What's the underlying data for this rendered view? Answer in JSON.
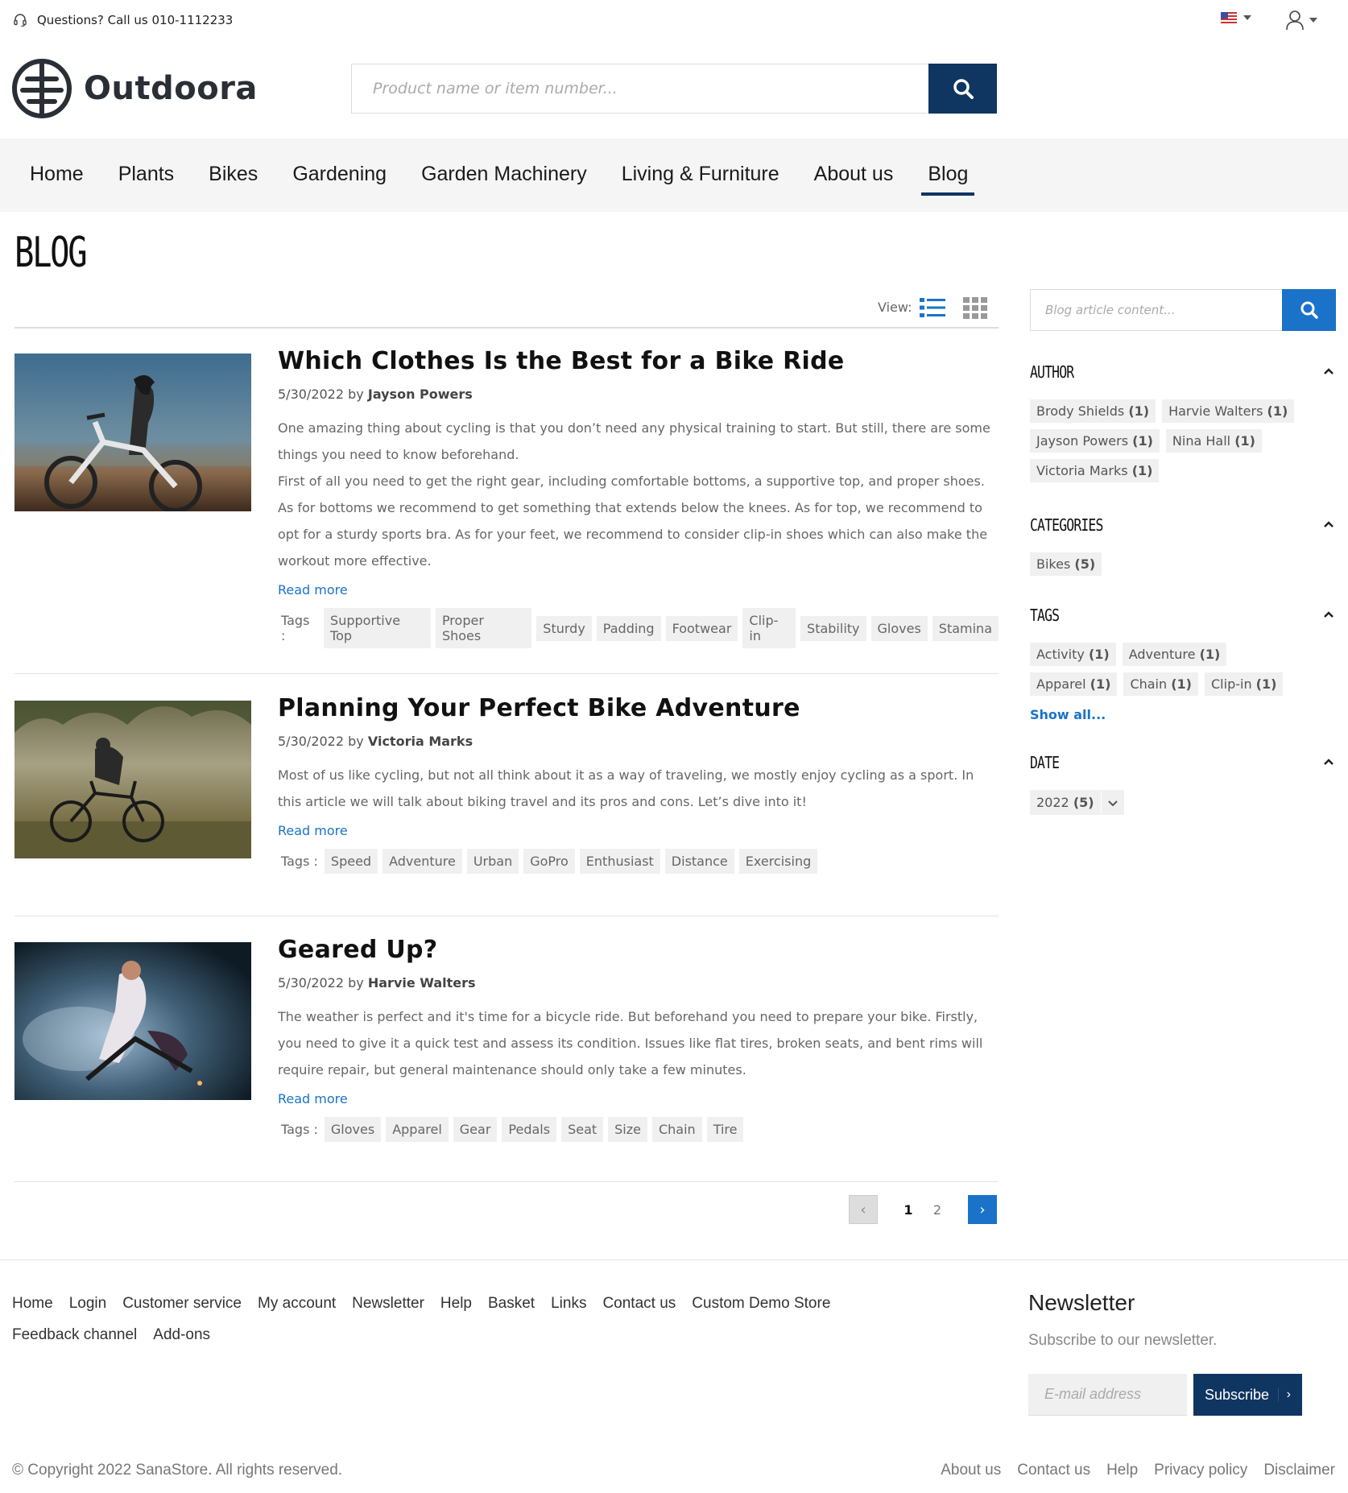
{
  "topbar": {
    "phone_text": "Questions? Call us 010-1112233",
    "language_icon": "us-flag-icon",
    "account_icon": "user-icon"
  },
  "header": {
    "logo_text": "Outdoora",
    "search_placeholder": "Product name or item number..."
  },
  "nav": {
    "items": [
      "Home",
      "Plants",
      "Bikes",
      "Gardening",
      "Garden Machinery",
      "Living & Furniture",
      "About us",
      "Blog"
    ],
    "active": "Blog"
  },
  "page": {
    "title": "BLOG",
    "view_label": "View:"
  },
  "articles": [
    {
      "title": "Which Clothes Is the Best for a Bike Ride",
      "date": "5/30/2022",
      "by": "by",
      "author": "Jayson Powers",
      "paragraphs": [
        "One amazing thing about cycling is that you don’t need any physical training to start. But still, there are some things you need to know beforehand.",
        "First of all you need to get the right gear, including comfortable bottoms, a supportive top, and proper shoes. As for bottoms we recommend to get something that extends below the knees. As for top, we recommend to opt for a sturdy sports bra. As for your feet, we recommend to consider clip-in shoes which can also make the workout more effective."
      ],
      "read_more": "Read more",
      "tags_label": "Tags :",
      "tags": [
        "Supportive Top",
        "Proper Shoes",
        "Sturdy",
        "Padding",
        "Footwear",
        "Clip-in",
        "Stability",
        "Gloves",
        "Stamina"
      ]
    },
    {
      "title": "Planning Your Perfect Bike Adventure",
      "date": "5/30/2022",
      "by": "by",
      "author": "Victoria Marks",
      "paragraphs": [
        "Most of us like cycling, but not all think about it as a way of traveling, we mostly enjoy cycling as a sport. In this article we will talk about  biking travel and  its pros and cons. Let’s dive into it!"
      ],
      "read_more": "Read more",
      "tags_label": "Tags :",
      "tags": [
        "Speed",
        "Adventure",
        "Urban",
        "GoPro",
        "Enthusiast",
        "Distance",
        "Exercising"
      ]
    },
    {
      "title": "Geared Up?",
      "date": "5/30/2022",
      "by": "by",
      "author": "Harvie Walters",
      "paragraphs": [
        "The weather is perfect and it's time for a bicycle ride. But beforehand you need to prepare your bike. Firstly, you need to give it a quick test and assess its condition. Issues like flat tires, broken seats, and bent rims will require repair, but general maintenance should only take a few minutes."
      ],
      "read_more": "Read more",
      "tags_label": "Tags :",
      "tags": [
        "Gloves",
        "Apparel",
        "Gear",
        "Pedals",
        "Seat",
        "Size",
        "Chain",
        "Tire"
      ]
    }
  ],
  "pagination": {
    "prev": "‹",
    "pages": [
      "1",
      "2"
    ],
    "current": "1",
    "next": "›"
  },
  "sidebar": {
    "search_placeholder": "Blog article content...",
    "facets": {
      "author": {
        "title": "AUTHOR",
        "items": [
          {
            "name": "Brody Shields",
            "count": "(1)"
          },
          {
            "name": "Harvie Walters",
            "count": "(1)"
          },
          {
            "name": "Jayson Powers",
            "count": "(1)"
          },
          {
            "name": "Nina Hall",
            "count": "(1)"
          },
          {
            "name": "Victoria Marks",
            "count": "(1)"
          }
        ]
      },
      "categories": {
        "title": "CATEGORIES",
        "items": [
          {
            "name": "Bikes",
            "count": "(5)"
          }
        ]
      },
      "tags": {
        "title": "TAGS",
        "items": [
          {
            "name": "Activity",
            "count": "(1)"
          },
          {
            "name": "Adventure",
            "count": "(1)"
          },
          {
            "name": "Apparel",
            "count": "(1)"
          },
          {
            "name": "Chain",
            "count": "(1)"
          },
          {
            "name": "Clip-in",
            "count": "(1)"
          }
        ],
        "show_all": "Show all..."
      },
      "date": {
        "title": "DATE",
        "year": "2022",
        "count": "(5)"
      }
    }
  },
  "footer": {
    "links": [
      "Home",
      "Login",
      "Customer service",
      "My account",
      "Newsletter",
      "Help",
      "Basket",
      "Links",
      "Contact us",
      "Custom Demo Store",
      "Feedback channel",
      "Add-ons"
    ],
    "newsletter_title": "Newsletter",
    "newsletter_sub": "Subscribe to our newsletter.",
    "email_placeholder": "E-mail address",
    "subscribe_label": "Subscribe",
    "subscribe_arrow": "›",
    "copyright": "© Copyright 2022 SanaStore. All rights reserved.",
    "bottom_links": [
      "About us",
      "Contact us",
      "Help",
      "Privacy policy",
      "Disclaimer"
    ]
  },
  "colors": {
    "brand_navy": "#0f3561",
    "accent_blue": "#1a73c9",
    "nav_bg": "#f5f5f5",
    "tag_bg": "#f0f0f0"
  }
}
